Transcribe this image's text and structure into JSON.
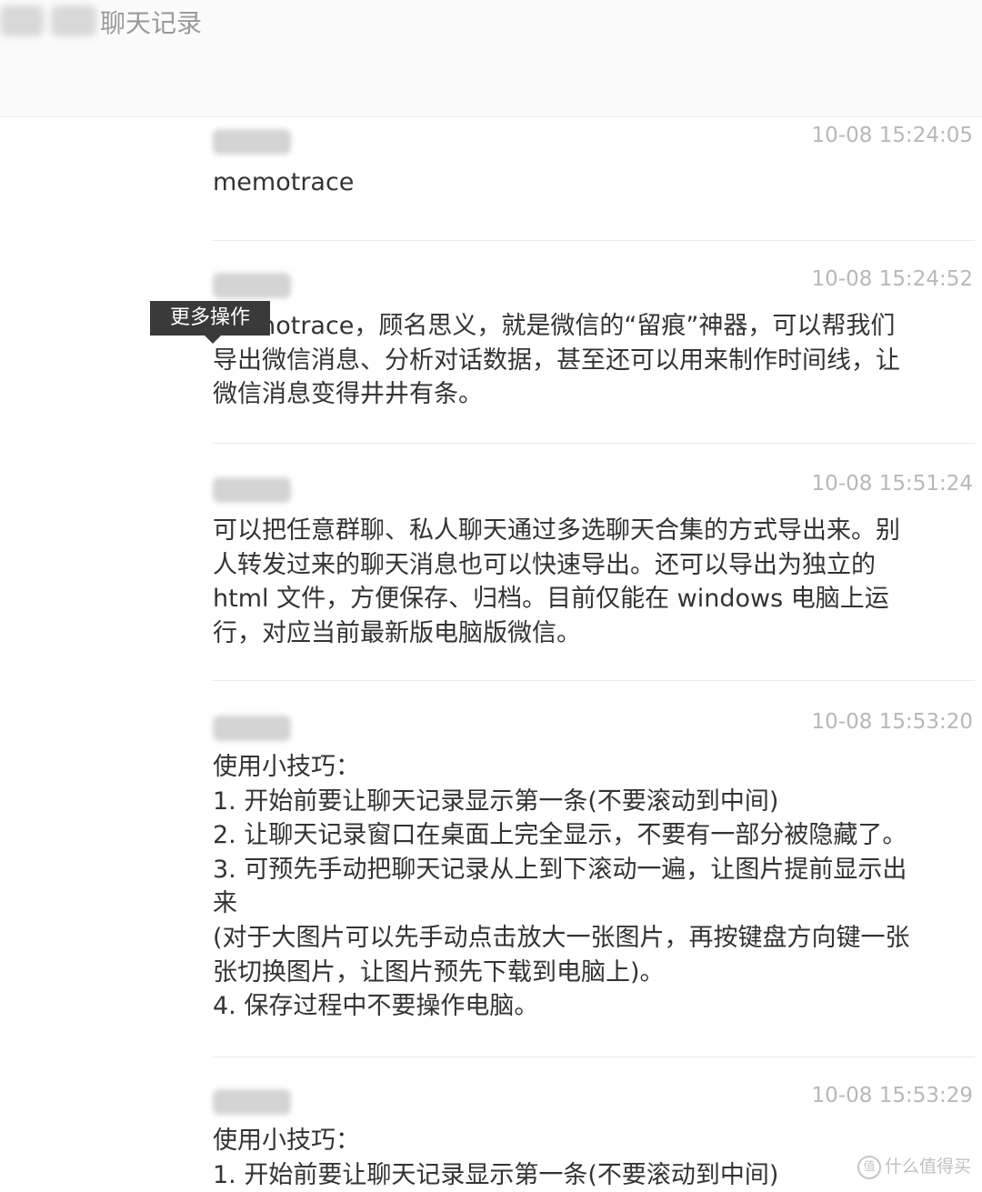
{
  "header": {
    "title": "聊天记录"
  },
  "tooltip": {
    "label": "更多操作"
  },
  "messages": [
    {
      "time": "10-08 15:24:05",
      "text": "memotrace"
    },
    {
      "time": "10-08 15:24:52",
      "text": "memotrace，顾名思义，就是微信的“留痕”神器，可以帮我们\n导出微信消息、分析对话数据，甚至还可以用来制作时间线，让\n微信消息变得井井有条。"
    },
    {
      "time": "10-08 15:51:24",
      "text": "可以把任意群聊、私人聊天通过多选聊天合集的方式导出来。别\n人转发过来的聊天消息也可以快速导出。还可以导出为独立的\nhtml 文件，方便保存、归档。目前仅能在 windows 电脑上运\n行，对应当前最新版电脑版微信。"
    },
    {
      "time": "10-08 15:53:20",
      "text": "使用小技巧：\n1. 开始前要让聊天记录显示第一条(不要滚动到中间)\n2. 让聊天记录窗口在桌面上完全显示，不要有一部分被隐藏了。\n3. 可预先手动把聊天记录从上到下滚动一遍，让图片提前显示出\n来\n(对于大图片可以先手动点击放大一张图片，再按键盘方向键一张\n张切换图片，让图片预先下载到电脑上)。\n4. 保存过程中不要操作电脑。"
    },
    {
      "time": "10-08 15:53:29",
      "text": "使用小技巧：\n1. 开始前要让聊天记录显示第一条(不要滚动到中间)"
    }
  ],
  "watermark": {
    "icon": "值",
    "text": "什么值得买"
  }
}
